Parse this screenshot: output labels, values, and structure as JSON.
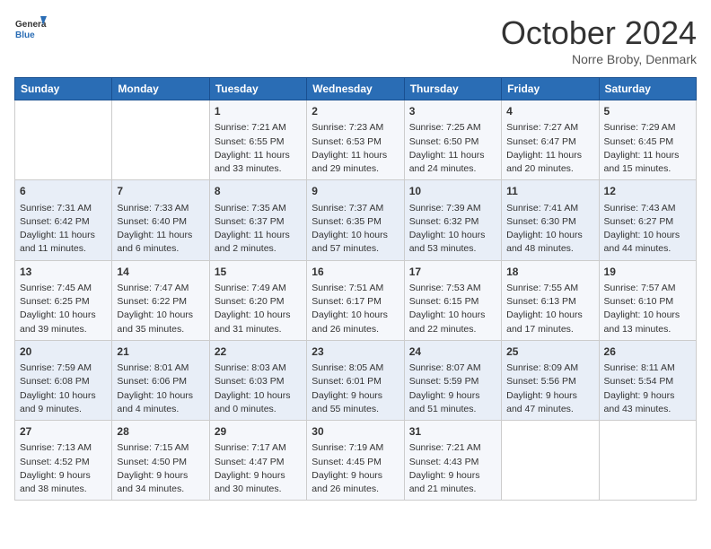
{
  "header": {
    "logo_line1": "General",
    "logo_line2": "Blue",
    "month": "October 2024",
    "location": "Norre Broby, Denmark"
  },
  "days_of_week": [
    "Sunday",
    "Monday",
    "Tuesday",
    "Wednesday",
    "Thursday",
    "Friday",
    "Saturday"
  ],
  "weeks": [
    [
      {
        "day": "",
        "info": ""
      },
      {
        "day": "",
        "info": ""
      },
      {
        "day": "1",
        "info": "Sunrise: 7:21 AM\nSunset: 6:55 PM\nDaylight: 11 hours\nand 33 minutes."
      },
      {
        "day": "2",
        "info": "Sunrise: 7:23 AM\nSunset: 6:53 PM\nDaylight: 11 hours\nand 29 minutes."
      },
      {
        "day": "3",
        "info": "Sunrise: 7:25 AM\nSunset: 6:50 PM\nDaylight: 11 hours\nand 24 minutes."
      },
      {
        "day": "4",
        "info": "Sunrise: 7:27 AM\nSunset: 6:47 PM\nDaylight: 11 hours\nand 20 minutes."
      },
      {
        "day": "5",
        "info": "Sunrise: 7:29 AM\nSunset: 6:45 PM\nDaylight: 11 hours\nand 15 minutes."
      }
    ],
    [
      {
        "day": "6",
        "info": "Sunrise: 7:31 AM\nSunset: 6:42 PM\nDaylight: 11 hours\nand 11 minutes."
      },
      {
        "day": "7",
        "info": "Sunrise: 7:33 AM\nSunset: 6:40 PM\nDaylight: 11 hours\nand 6 minutes."
      },
      {
        "day": "8",
        "info": "Sunrise: 7:35 AM\nSunset: 6:37 PM\nDaylight: 11 hours\nand 2 minutes."
      },
      {
        "day": "9",
        "info": "Sunrise: 7:37 AM\nSunset: 6:35 PM\nDaylight: 10 hours\nand 57 minutes."
      },
      {
        "day": "10",
        "info": "Sunrise: 7:39 AM\nSunset: 6:32 PM\nDaylight: 10 hours\nand 53 minutes."
      },
      {
        "day": "11",
        "info": "Sunrise: 7:41 AM\nSunset: 6:30 PM\nDaylight: 10 hours\nand 48 minutes."
      },
      {
        "day": "12",
        "info": "Sunrise: 7:43 AM\nSunset: 6:27 PM\nDaylight: 10 hours\nand 44 minutes."
      }
    ],
    [
      {
        "day": "13",
        "info": "Sunrise: 7:45 AM\nSunset: 6:25 PM\nDaylight: 10 hours\nand 39 minutes."
      },
      {
        "day": "14",
        "info": "Sunrise: 7:47 AM\nSunset: 6:22 PM\nDaylight: 10 hours\nand 35 minutes."
      },
      {
        "day": "15",
        "info": "Sunrise: 7:49 AM\nSunset: 6:20 PM\nDaylight: 10 hours\nand 31 minutes."
      },
      {
        "day": "16",
        "info": "Sunrise: 7:51 AM\nSunset: 6:17 PM\nDaylight: 10 hours\nand 26 minutes."
      },
      {
        "day": "17",
        "info": "Sunrise: 7:53 AM\nSunset: 6:15 PM\nDaylight: 10 hours\nand 22 minutes."
      },
      {
        "day": "18",
        "info": "Sunrise: 7:55 AM\nSunset: 6:13 PM\nDaylight: 10 hours\nand 17 minutes."
      },
      {
        "day": "19",
        "info": "Sunrise: 7:57 AM\nSunset: 6:10 PM\nDaylight: 10 hours\nand 13 minutes."
      }
    ],
    [
      {
        "day": "20",
        "info": "Sunrise: 7:59 AM\nSunset: 6:08 PM\nDaylight: 10 hours\nand 9 minutes."
      },
      {
        "day": "21",
        "info": "Sunrise: 8:01 AM\nSunset: 6:06 PM\nDaylight: 10 hours\nand 4 minutes."
      },
      {
        "day": "22",
        "info": "Sunrise: 8:03 AM\nSunset: 6:03 PM\nDaylight: 10 hours\nand 0 minutes."
      },
      {
        "day": "23",
        "info": "Sunrise: 8:05 AM\nSunset: 6:01 PM\nDaylight: 9 hours\nand 55 minutes."
      },
      {
        "day": "24",
        "info": "Sunrise: 8:07 AM\nSunset: 5:59 PM\nDaylight: 9 hours\nand 51 minutes."
      },
      {
        "day": "25",
        "info": "Sunrise: 8:09 AM\nSunset: 5:56 PM\nDaylight: 9 hours\nand 47 minutes."
      },
      {
        "day": "26",
        "info": "Sunrise: 8:11 AM\nSunset: 5:54 PM\nDaylight: 9 hours\nand 43 minutes."
      }
    ],
    [
      {
        "day": "27",
        "info": "Sunrise: 7:13 AM\nSunset: 4:52 PM\nDaylight: 9 hours\nand 38 minutes."
      },
      {
        "day": "28",
        "info": "Sunrise: 7:15 AM\nSunset: 4:50 PM\nDaylight: 9 hours\nand 34 minutes."
      },
      {
        "day": "29",
        "info": "Sunrise: 7:17 AM\nSunset: 4:47 PM\nDaylight: 9 hours\nand 30 minutes."
      },
      {
        "day": "30",
        "info": "Sunrise: 7:19 AM\nSunset: 4:45 PM\nDaylight: 9 hours\nand 26 minutes."
      },
      {
        "day": "31",
        "info": "Sunrise: 7:21 AM\nSunset: 4:43 PM\nDaylight: 9 hours\nand 21 minutes."
      },
      {
        "day": "",
        "info": ""
      },
      {
        "day": "",
        "info": ""
      }
    ]
  ]
}
